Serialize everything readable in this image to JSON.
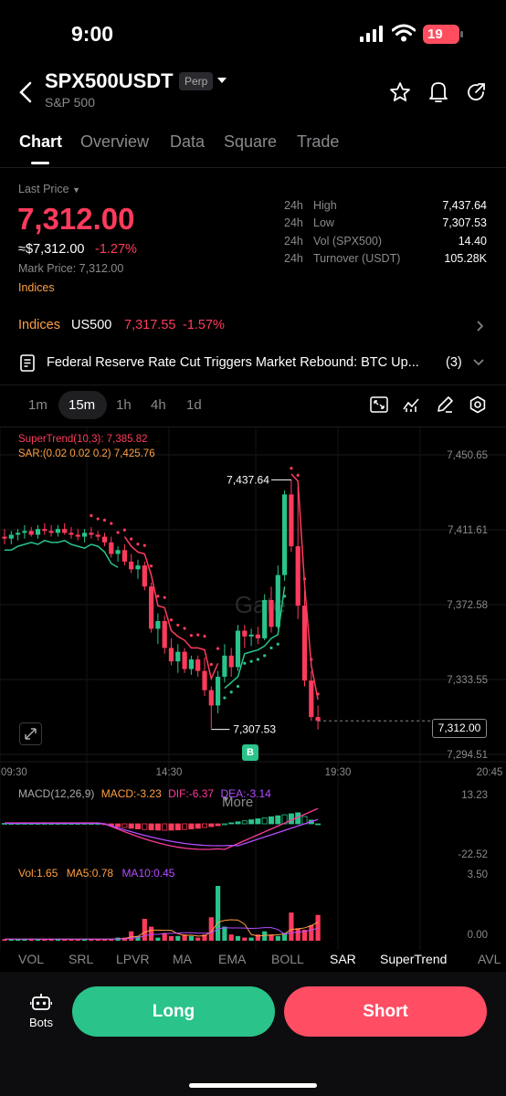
{
  "status_bar": {
    "time": "9:00",
    "battery": "19"
  },
  "header": {
    "symbol": "SPX500USDT",
    "badge": "Perp",
    "subtitle": "S&P 500"
  },
  "tabs": [
    "Chart",
    "Overview",
    "Data",
    "Square",
    "Trade"
  ],
  "price": {
    "last_price_label": "Last Price",
    "last_price": "7,312.00",
    "usd_value": "≈$7,312.00",
    "change_pct": "-1.27%",
    "mark_price": "Mark Price: 7,312.00",
    "category": "Indices"
  },
  "stats": [
    {
      "period": "24h",
      "label": "High",
      "value": "7,437.64"
    },
    {
      "period": "24h",
      "label": "Low",
      "value": "7,307.53"
    },
    {
      "period": "24h",
      "label": "Vol (SPX500)",
      "value": "14.40"
    },
    {
      "period": "24h",
      "label": "Turnover (USDT)",
      "value": "105.28K"
    }
  ],
  "index_row": {
    "label": "Indices",
    "name": "US500",
    "price": "7,317.55",
    "change": "-1.57%"
  },
  "news": {
    "headline": "Federal Reserve Rate Cut Triggers Market Rebound: BTC Up...",
    "count": "(3)"
  },
  "timeframes": {
    "items": [
      "1m",
      "15m",
      "1h",
      "4h",
      "1d"
    ],
    "selected": "15m",
    "more": "More"
  },
  "chart_data": {
    "type": "candlestick",
    "overlays": {
      "supertrend": "SuperTrend(10,3): 7,385.82",
      "sar": "SAR:(0.02 0.02 0.2) 7,425.76"
    },
    "y_ticks": [
      "7,450.65",
      "7,411.61",
      "7,372.58",
      "7,333.55",
      "7,294.51"
    ],
    "ylim": [
      7294.51,
      7450.65
    ],
    "x_ticks": [
      "09:30",
      "14:30",
      "19:30",
      "20:45"
    ],
    "high_label": "7,437.64",
    "low_label": "7,307.53",
    "current_price": "7,312.00",
    "buy_marker": "B",
    "watermark": "Gate",
    "candles": [
      {
        "o": 7408,
        "h": 7412,
        "l": 7404,
        "c": 7407
      },
      {
        "o": 7407,
        "h": 7411,
        "l": 7404,
        "c": 7409
      },
      {
        "o": 7409,
        "h": 7412,
        "l": 7406,
        "c": 7410
      },
      {
        "o": 7410,
        "h": 7414,
        "l": 7407,
        "c": 7411
      },
      {
        "o": 7411,
        "h": 7413,
        "l": 7408,
        "c": 7409
      },
      {
        "o": 7409,
        "h": 7414,
        "l": 7407,
        "c": 7412
      },
      {
        "o": 7412,
        "h": 7415,
        "l": 7409,
        "c": 7411
      },
      {
        "o": 7411,
        "h": 7414,
        "l": 7408,
        "c": 7410
      },
      {
        "o": 7410,
        "h": 7414,
        "l": 7408,
        "c": 7412
      },
      {
        "o": 7412,
        "h": 7415,
        "l": 7409,
        "c": 7410
      },
      {
        "o": 7410,
        "h": 7413,
        "l": 7407,
        "c": 7409
      },
      {
        "o": 7409,
        "h": 7412,
        "l": 7406,
        "c": 7408
      },
      {
        "o": 7408,
        "h": 7412,
        "l": 7405,
        "c": 7410
      },
      {
        "o": 7410,
        "h": 7413,
        "l": 7407,
        "c": 7409
      },
      {
        "o": 7409,
        "h": 7411,
        "l": 7406,
        "c": 7408
      },
      {
        "o": 7408,
        "h": 7410,
        "l": 7403,
        "c": 7405
      },
      {
        "o": 7405,
        "h": 7408,
        "l": 7397,
        "c": 7399
      },
      {
        "o": 7399,
        "h": 7403,
        "l": 7395,
        "c": 7401
      },
      {
        "o": 7401,
        "h": 7404,
        "l": 7393,
        "c": 7395
      },
      {
        "o": 7395,
        "h": 7399,
        "l": 7389,
        "c": 7391
      },
      {
        "o": 7391,
        "h": 7396,
        "l": 7386,
        "c": 7393
      },
      {
        "o": 7393,
        "h": 7395,
        "l": 7380,
        "c": 7382
      },
      {
        "o": 7382,
        "h": 7384,
        "l": 7358,
        "c": 7360
      },
      {
        "o": 7360,
        "h": 7368,
        "l": 7352,
        "c": 7364
      },
      {
        "o": 7364,
        "h": 7367,
        "l": 7347,
        "c": 7350
      },
      {
        "o": 7350,
        "h": 7355,
        "l": 7341,
        "c": 7343
      },
      {
        "o": 7343,
        "h": 7352,
        "l": 7337,
        "c": 7348
      },
      {
        "o": 7348,
        "h": 7350,
        "l": 7337,
        "c": 7339
      },
      {
        "o": 7339,
        "h": 7346,
        "l": 7336,
        "c": 7344
      },
      {
        "o": 7344,
        "h": 7346,
        "l": 7335,
        "c": 7338
      },
      {
        "o": 7338,
        "h": 7345,
        "l": 7325,
        "c": 7328
      },
      {
        "o": 7328,
        "h": 7330,
        "l": 7308,
        "c": 7320
      },
      {
        "o": 7320,
        "h": 7338,
        "l": 7316,
        "c": 7335
      },
      {
        "o": 7335,
        "h": 7352,
        "l": 7332,
        "c": 7346
      },
      {
        "o": 7346,
        "h": 7350,
        "l": 7335,
        "c": 7340
      },
      {
        "o": 7340,
        "h": 7362,
        "l": 7338,
        "c": 7359
      },
      {
        "o": 7359,
        "h": 7362,
        "l": 7350,
        "c": 7356
      },
      {
        "o": 7356,
        "h": 7360,
        "l": 7351,
        "c": 7357
      },
      {
        "o": 7357,
        "h": 7361,
        "l": 7352,
        "c": 7355
      },
      {
        "o": 7355,
        "h": 7378,
        "l": 7354,
        "c": 7375
      },
      {
        "o": 7375,
        "h": 7382,
        "l": 7358,
        "c": 7361
      },
      {
        "o": 7361,
        "h": 7393,
        "l": 7360,
        "c": 7388
      },
      {
        "o": 7388,
        "h": 7432,
        "l": 7385,
        "c": 7430
      },
      {
        "o": 7430,
        "h": 7437.64,
        "l": 7400,
        "c": 7403
      },
      {
        "o": 7403,
        "h": 7434,
        "l": 7365,
        "c": 7372
      },
      {
        "o": 7372,
        "h": 7380,
        "l": 7330,
        "c": 7333
      },
      {
        "o": 7333,
        "h": 7338,
        "l": 7312,
        "c": 7314
      },
      {
        "o": 7314,
        "h": 7320,
        "l": 7307.53,
        "c": 7312
      }
    ],
    "macd": {
      "label": "MACD(12,26,9)",
      "macd": "MACD:-3.23",
      "dif": "DIF:-6.37",
      "dea": "DEA:-3.14",
      "y_ticks": [
        "13.23",
        "-22.52"
      ]
    },
    "volume": {
      "vol": "Vol:1.65",
      "ma5": "MA5:0.78",
      "ma10": "MA10:0.45",
      "y_ticks": [
        "3.50",
        "0.00"
      ]
    }
  },
  "indicators": [
    "VOL",
    "SRL",
    "LPVR",
    "MA",
    "EMA",
    "BOLL",
    "SAR",
    "SuperTrend",
    "AVL"
  ],
  "selected_indicator": "SAR",
  "bottom": {
    "bots": "Bots",
    "long": "Long",
    "short": "Short"
  },
  "colors": {
    "up": "#2ac38a",
    "down": "#ff3b5c",
    "supertrend": "#ff3b5c",
    "sar": "#ff9f43",
    "macd_dif": "#ff3b9a",
    "macd_dea": "#b44dff"
  }
}
